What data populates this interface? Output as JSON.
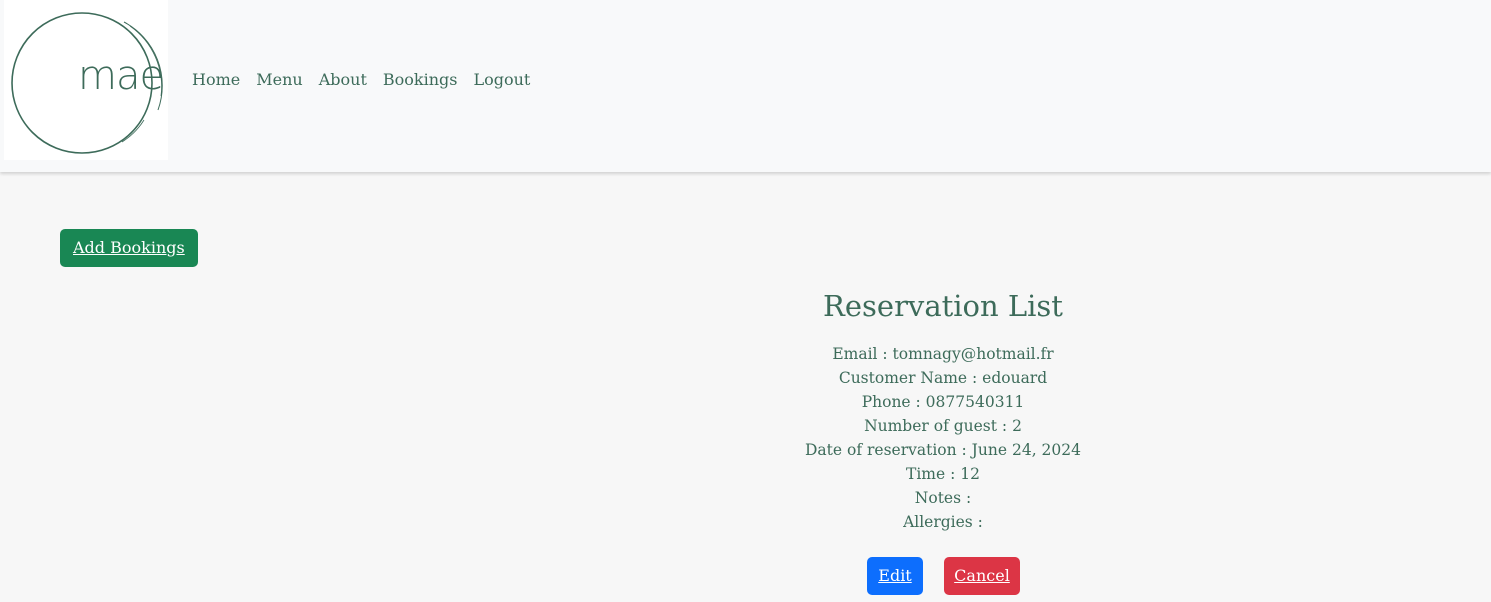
{
  "logo": {
    "text": "mae"
  },
  "nav": {
    "items": [
      "Home",
      "Menu",
      "About",
      "Bookings",
      "Logout"
    ]
  },
  "actions": {
    "add_bookings": "Add Bookings"
  },
  "reservation": {
    "title": "Reservation List",
    "email": "Email : tomnagy@hotmail.fr",
    "customer_name": "Customer Name : edouard",
    "phone": "Phone : 0877540311",
    "guests": "Number of guest : 2",
    "date": "Date of reservation : June 24, 2024",
    "time": "Time : 12",
    "notes": "Notes :",
    "allergies": "Allergies :",
    "edit_label": "Edit",
    "cancel_label": "Cancel"
  },
  "colors": {
    "text": "#3d6b5a",
    "add_button": "#198754",
    "edit_button": "#0d6efd",
    "cancel_button": "#dc3545"
  }
}
